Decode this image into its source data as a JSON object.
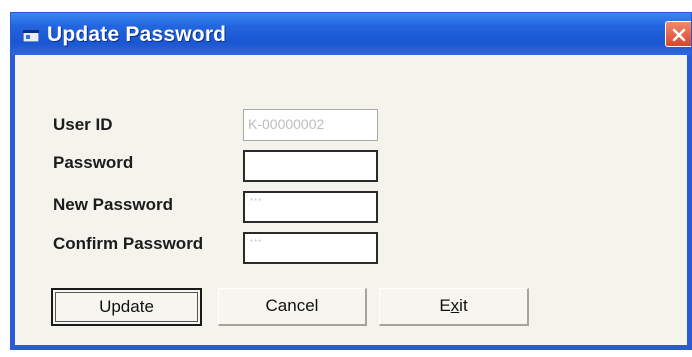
{
  "window": {
    "title": "Update Password",
    "icons": {
      "title_icon": "app-window-icon",
      "close": "close-icon"
    },
    "colors": {
      "titlebar": "#2466e0",
      "close": "#d9452b",
      "body": "#f4f3ec"
    }
  },
  "form": {
    "user_id": {
      "label": "User ID",
      "value": "K-00000002",
      "state": "disabled"
    },
    "password": {
      "label": "Password",
      "value": ""
    },
    "new_password": {
      "label": "New Password",
      "value": "***"
    },
    "confirm_password": {
      "label": "Confirm Password",
      "value": "***"
    }
  },
  "buttons": {
    "update": {
      "label": "Update",
      "mnemonic": "U",
      "default": true
    },
    "cancel": {
      "label": "Cancel",
      "mnemonic": "C"
    },
    "exit": {
      "label": "Exit",
      "mnemonic": "x"
    }
  }
}
